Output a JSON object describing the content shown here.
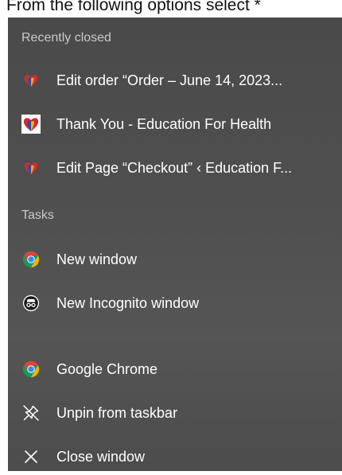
{
  "caption": "From the following options select *",
  "jump_list": {
    "recent_header": "Recently closed",
    "recent_items": [
      {
        "label": "Edit order “Order – June 14, 2023...",
        "icon": "site-favicon-icon"
      },
      {
        "label": "Thank You - Education For Health",
        "icon": "site-favicon-icon"
      },
      {
        "label": "Edit Page “Checkout” ‹ Education F...",
        "icon": "site-favicon-icon"
      }
    ],
    "tasks_header": "Tasks",
    "tasks": [
      {
        "label": "New window",
        "icon": "chrome-icon"
      },
      {
        "label": "New Incognito window",
        "icon": "incognito-icon"
      }
    ],
    "app_items": [
      {
        "label": "Google Chrome",
        "icon": "chrome-icon"
      },
      {
        "label": "Unpin from taskbar",
        "icon": "unpin-icon"
      },
      {
        "label": "Close window",
        "icon": "close-icon"
      }
    ]
  },
  "colors": {
    "panel_bg": "#4f4f4f",
    "text": "#ffffff",
    "header_text": "#c9c9c9",
    "chrome_red": "#db4437",
    "chrome_yellow": "#f4b400",
    "chrome_green": "#0f9d58",
    "chrome_blue": "#4285f4"
  }
}
